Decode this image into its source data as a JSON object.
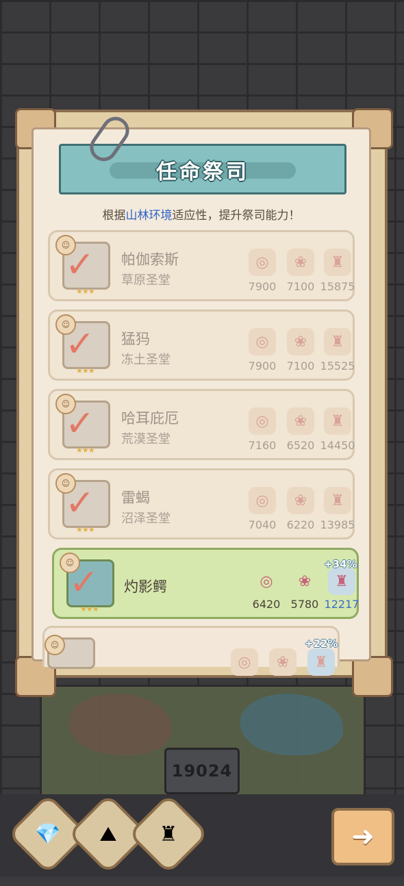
{
  "panel": {
    "title": "任命祭司",
    "subtitle_before": "根据",
    "subtitle_highlight": "山林环境",
    "subtitle_after": "适应性，提升祭司能力！"
  },
  "candidates": [
    {
      "name": "帕伽索斯",
      "temple": "草原圣堂",
      "values": [
        "7900",
        "7100",
        "15875"
      ],
      "state": "assigned"
    },
    {
      "name": "猛犸",
      "temple": "冻土圣堂",
      "values": [
        "7900",
        "7100",
        "15525"
      ],
      "state": "assigned"
    },
    {
      "name": "哈耳庇厄",
      "temple": "荒漠圣堂",
      "values": [
        "7160",
        "6520",
        "14450"
      ],
      "state": "assigned"
    },
    {
      "name": "雷蝎",
      "temple": "沼泽圣堂",
      "values": [
        "7040",
        "6220",
        "13985"
      ],
      "state": "assigned"
    },
    {
      "name": "灼影鳄",
      "temple": "",
      "values": [
        "6420",
        "5780",
        "12217"
      ],
      "bonus": "+34%",
      "state": "selected"
    },
    {
      "name": "",
      "temple": "",
      "values": [],
      "bonus": "+22%",
      "state": "partial"
    }
  ],
  "icons": {
    "resource_1": "shell-icon",
    "resource_2": "orb-icon",
    "resource_3": "totem-icon",
    "assigned": "checkmark-icon",
    "rank": "star-icon"
  },
  "scene": {
    "power_value": "19024"
  },
  "colors": {
    "selected_card": "#d6e8ad",
    "boost_text": "#3d6cc9",
    "check": "#e27967",
    "banner": "#86c0c0"
  }
}
